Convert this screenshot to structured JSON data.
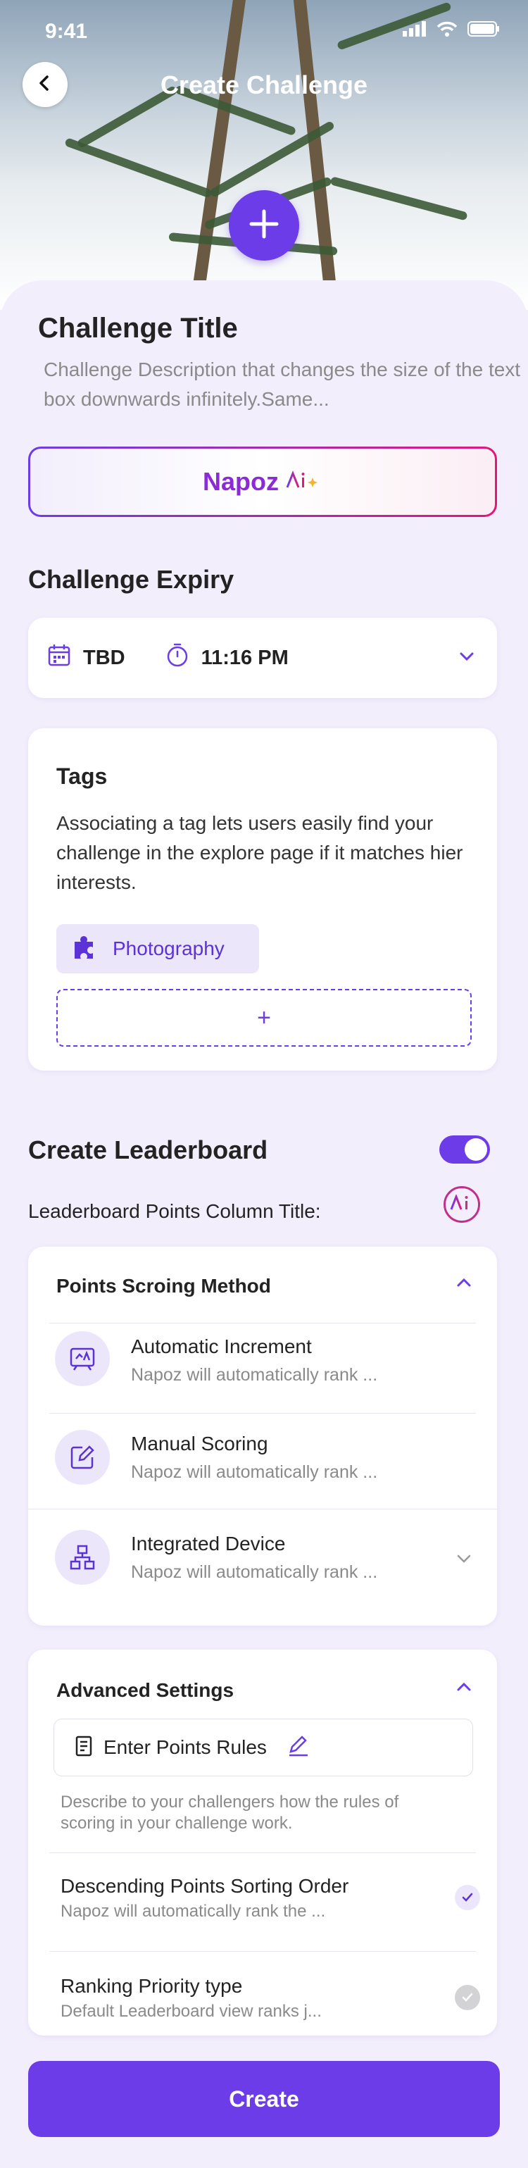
{
  "status_bar": {
    "time": "9:41"
  },
  "header": {
    "title": "Create Challenge"
  },
  "challenge": {
    "title": "Challenge Title",
    "description": "Challenge Description that changes the size of the text box downwards infinitely.Same..."
  },
  "ai_button": {
    "brand": "Napoz",
    "ai_mark": "Ai"
  },
  "expiry": {
    "heading": "Challenge Expiry",
    "date": "TBD",
    "time": "11:16 PM"
  },
  "tags": {
    "heading": "Tags",
    "description": "Associating a tag lets users easily find your challenge in the explore page if it matches hier interests.",
    "items": [
      {
        "label": "Photography"
      }
    ],
    "add_symbol": "+"
  },
  "leaderboard": {
    "heading": "Create Leaderboard",
    "enabled": true,
    "column_title_label": "Leaderboard Points Column Title:",
    "ai_mark": "Ai"
  },
  "scoring": {
    "heading": "Points Scroing Method",
    "options": [
      {
        "title": "Automatic Increment",
        "subtitle": "Napoz will automatically  rank ..."
      },
      {
        "title": "Manual Scoring",
        "subtitle": "Napoz will automatically  rank ..."
      },
      {
        "title": "Integrated Device",
        "subtitle": "Napoz will automatically  rank ..."
      }
    ]
  },
  "advanced": {
    "heading": "Advanced Settings",
    "rules_label": "Enter Points Rules",
    "rules_description": "Describe to your challengers how the rules of scoring in your challenge work.",
    "settings": [
      {
        "title": "Descending Points Sorting Order",
        "subtitle": "Napoz will automatically rank the ...",
        "checked": true
      },
      {
        "title": "Ranking Priority type",
        "subtitle": "Default Leaderboard view ranks j...",
        "checked": false
      }
    ]
  },
  "create_button": {
    "label": "Create"
  },
  "colors": {
    "accent": "#6c3ce9",
    "background": "#f3eefc",
    "brand_gradient_end": "#e0187a"
  }
}
